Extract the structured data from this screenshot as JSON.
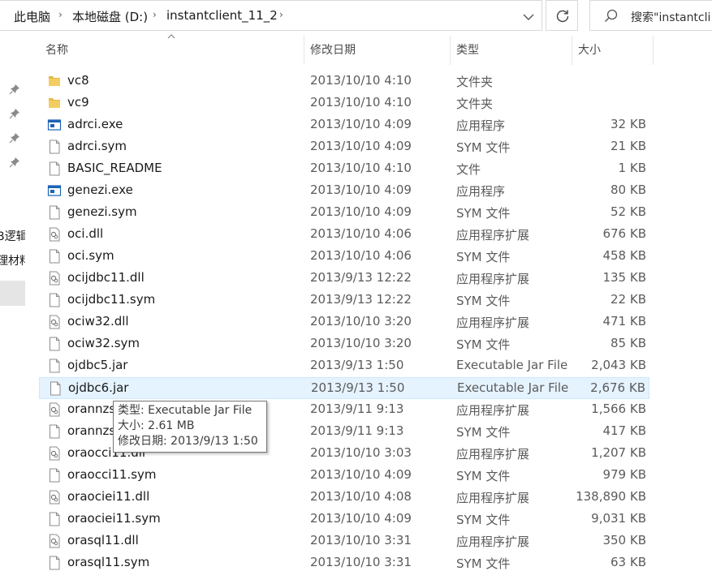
{
  "address": {
    "crumbs": [
      "此电脑",
      "本地磁盘 (D:)",
      "instantclient_11_2"
    ],
    "search_placeholder": "搜索\"instantcli"
  },
  "nav": {
    "items": [
      "B逻辑",
      "理材料"
    ]
  },
  "columns": {
    "name": "名称",
    "date": "修改日期",
    "type": "类型",
    "size": "大小"
  },
  "files": [
    {
      "name": "vc8",
      "date": "2013/10/10 4:10",
      "type": "文件夹",
      "size": "",
      "icon": "folder-icon"
    },
    {
      "name": "vc9",
      "date": "2013/10/10 4:10",
      "type": "文件夹",
      "size": "",
      "icon": "folder-icon"
    },
    {
      "name": "adrci.exe",
      "date": "2013/10/10 4:09",
      "type": "应用程序",
      "size": "32 KB",
      "icon": "exe-icon"
    },
    {
      "name": "adrci.sym",
      "date": "2013/10/10 4:09",
      "type": "SYM 文件",
      "size": "21 KB",
      "icon": "file-icon"
    },
    {
      "name": "BASIC_README",
      "date": "2013/10/10 4:10",
      "type": "文件",
      "size": "1 KB",
      "icon": "file-icon"
    },
    {
      "name": "genezi.exe",
      "date": "2013/10/10 4:09",
      "type": "应用程序",
      "size": "80 KB",
      "icon": "exe-icon"
    },
    {
      "name": "genezi.sym",
      "date": "2013/10/10 4:09",
      "type": "SYM 文件",
      "size": "52 KB",
      "icon": "file-icon"
    },
    {
      "name": "oci.dll",
      "date": "2013/10/10 4:06",
      "type": "应用程序扩展",
      "size": "676 KB",
      "icon": "dll-icon"
    },
    {
      "name": "oci.sym",
      "date": "2013/10/10 4:06",
      "type": "SYM 文件",
      "size": "458 KB",
      "icon": "file-icon"
    },
    {
      "name": "ocijdbc11.dll",
      "date": "2013/9/13 12:22",
      "type": "应用程序扩展",
      "size": "135 KB",
      "icon": "dll-icon"
    },
    {
      "name": "ocijdbc11.sym",
      "date": "2013/9/13 12:22",
      "type": "SYM 文件",
      "size": "22 KB",
      "icon": "file-icon"
    },
    {
      "name": "ociw32.dll",
      "date": "2013/10/10 3:20",
      "type": "应用程序扩展",
      "size": "471 KB",
      "icon": "dll-icon"
    },
    {
      "name": "ociw32.sym",
      "date": "2013/10/10 3:20",
      "type": "SYM 文件",
      "size": "85 KB",
      "icon": "file-icon"
    },
    {
      "name": "ojdbc5.jar",
      "date": "2013/9/13 1:50",
      "type": "Executable Jar File",
      "size": "2,043 KB",
      "icon": "file-icon"
    },
    {
      "name": "ojdbc6.jar",
      "date": "2013/9/13 1:50",
      "type": "Executable Jar File",
      "size": "2,676 KB",
      "icon": "file-icon",
      "selected": true
    },
    {
      "name": "orannzs",
      "date": "2013/9/11 9:13",
      "type": "应用程序扩展",
      "size": "1,566 KB",
      "icon": "dll-icon"
    },
    {
      "name": "orannzs",
      "date": "2013/9/11 9:13",
      "type": "SYM 文件",
      "size": "417 KB",
      "icon": "file-icon"
    },
    {
      "name": "oraocci11.dll",
      "date": "2013/10/10 3:03",
      "type": "应用程序扩展",
      "size": "1,207 KB",
      "icon": "dll-icon"
    },
    {
      "name": "oraocci11.sym",
      "date": "2013/10/10 4:09",
      "type": "SYM 文件",
      "size": "979 KB",
      "icon": "file-icon"
    },
    {
      "name": "oraociei11.dll",
      "date": "2013/10/10 4:08",
      "type": "应用程序扩展",
      "size": "138,890 KB",
      "icon": "dll-icon"
    },
    {
      "name": "oraociei11.sym",
      "date": "2013/10/10 4:09",
      "type": "SYM 文件",
      "size": "9,031 KB",
      "icon": "file-icon"
    },
    {
      "name": "orasql11.dll",
      "date": "2013/10/10 3:31",
      "type": "应用程序扩展",
      "size": "350 KB",
      "icon": "dll-icon"
    },
    {
      "name": "orasql11.sym",
      "date": "2013/10/10 3:31",
      "type": "SYM 文件",
      "size": "63 KB",
      "icon": "file-icon"
    }
  ],
  "tooltip": {
    "type_line": "类型: Executable Jar File",
    "size_line": "大小: 2.61 MB",
    "date_line": "修改日期: 2013/9/13 1:50"
  },
  "colors": {
    "folder": "#e8b84a",
    "selection_bg": "#e5f3ff",
    "selection_border": "#cce8ff",
    "exe_blue": "#1e63b5"
  }
}
